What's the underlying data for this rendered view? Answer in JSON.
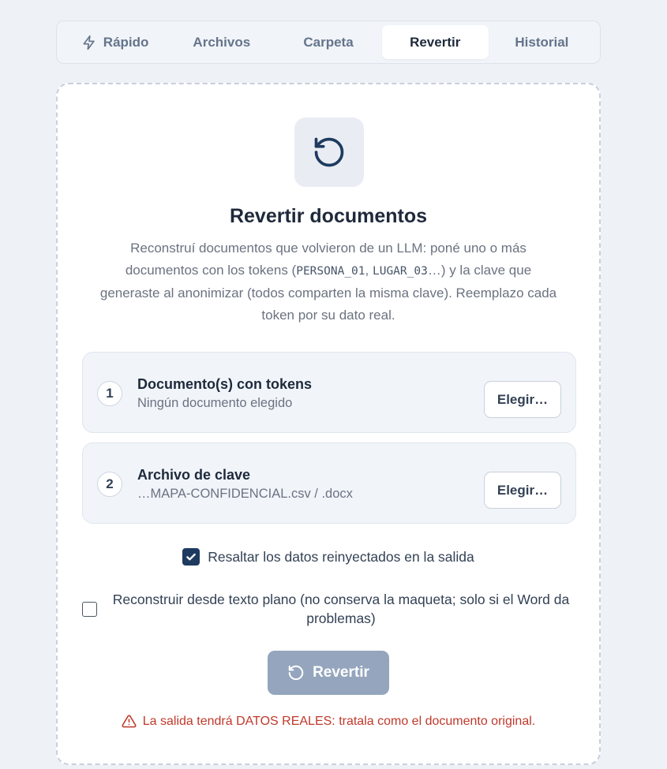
{
  "tabs": [
    {
      "label": "Rápido",
      "icon": "zap-icon",
      "active": false
    },
    {
      "label": "Archivos",
      "active": false
    },
    {
      "label": "Carpeta",
      "active": false
    },
    {
      "label": "Revertir",
      "active": true
    },
    {
      "label": "Historial",
      "active": false
    }
  ],
  "card": {
    "icon": "rotate-ccw-icon",
    "title": "Revertir documentos",
    "desc_part1": "Reconstruí documentos que volvieron de un LLM: poné uno o más documentos con los tokens (",
    "desc_code1": "PERSONA_01",
    "desc_sep": ", ",
    "desc_code2": "LUGAR_03",
    "desc_part2": "…) y la clave que generaste al anonimizar (todos comparten la misma clave). Reemplazo cada token por su dato real."
  },
  "steps": [
    {
      "number": "1",
      "title": "Documento(s) con tokens",
      "subtitle": "Ningún documento elegido",
      "button": "Elegir…"
    },
    {
      "number": "2",
      "title": "Archivo de clave",
      "subtitle": "…MAPA-CONFIDENCIAL.csv / .docx",
      "button": "Elegir…"
    }
  ],
  "options": {
    "highlight": {
      "label": "Resaltar los datos reinyectados en la salida",
      "checked": true
    },
    "plaintext": {
      "label": "Reconstruir desde texto plano (no conserva la maqueta; solo si el Word da problemas)",
      "checked": false
    }
  },
  "action": {
    "label": "Revertir",
    "icon": "rotate-ccw-icon"
  },
  "warning": {
    "text": "La salida tendrá DATOS REALES: tratala como el documento original.",
    "icon": "alert-triangle-icon"
  },
  "colors": {
    "accent": "#1e3a5f",
    "button_disabled": "#94a5bd",
    "warning": "#c0392b",
    "background": "#eef1f6"
  }
}
